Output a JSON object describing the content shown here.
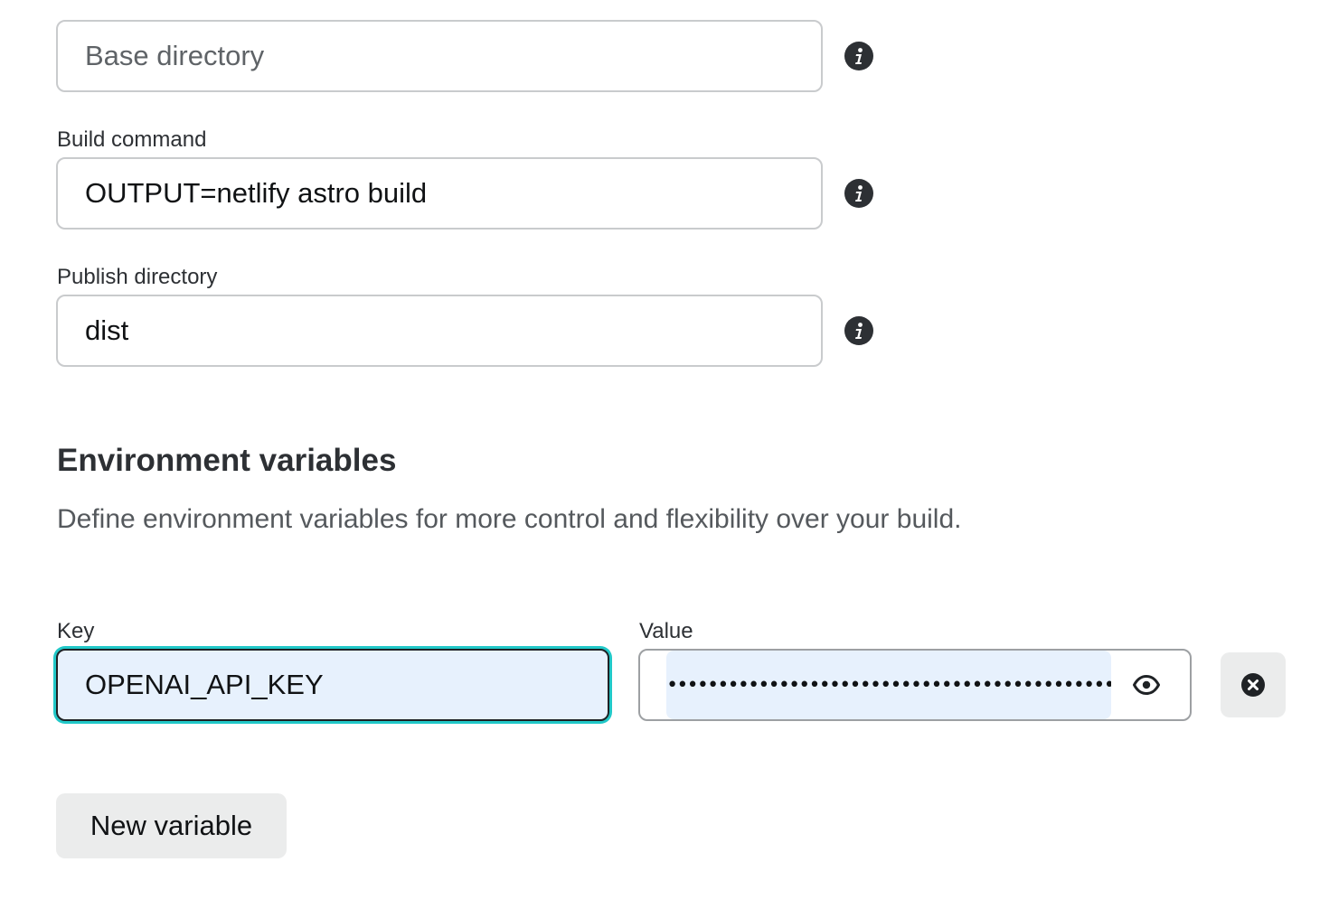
{
  "build_settings": {
    "base_directory": {
      "placeholder": "Base directory",
      "value": ""
    },
    "build_command": {
      "label": "Build command",
      "value": "OUTPUT=netlify astro build"
    },
    "publish_directory": {
      "label": "Publish directory",
      "value": "dist"
    }
  },
  "env": {
    "heading": "Environment variables",
    "description": "Define environment variables for more control and flexibility over your build.",
    "key_label": "Key",
    "value_label": "Value",
    "rows": [
      {
        "key": "OPENAI_API_KEY",
        "masked_value": "••••••••••••••••••••••••••••••••••••••••••••••••••••"
      }
    ],
    "new_variable_label": "New variable"
  },
  "icons": {
    "info": "info-icon",
    "show_value": "eye-icon",
    "remove": "close-circle-icon"
  },
  "colors": {
    "focus_ring": "#21c8c8",
    "autofill_bg": "#e7f1fd",
    "text_dark": "#2d3034",
    "button_bg": "#ebecec"
  }
}
